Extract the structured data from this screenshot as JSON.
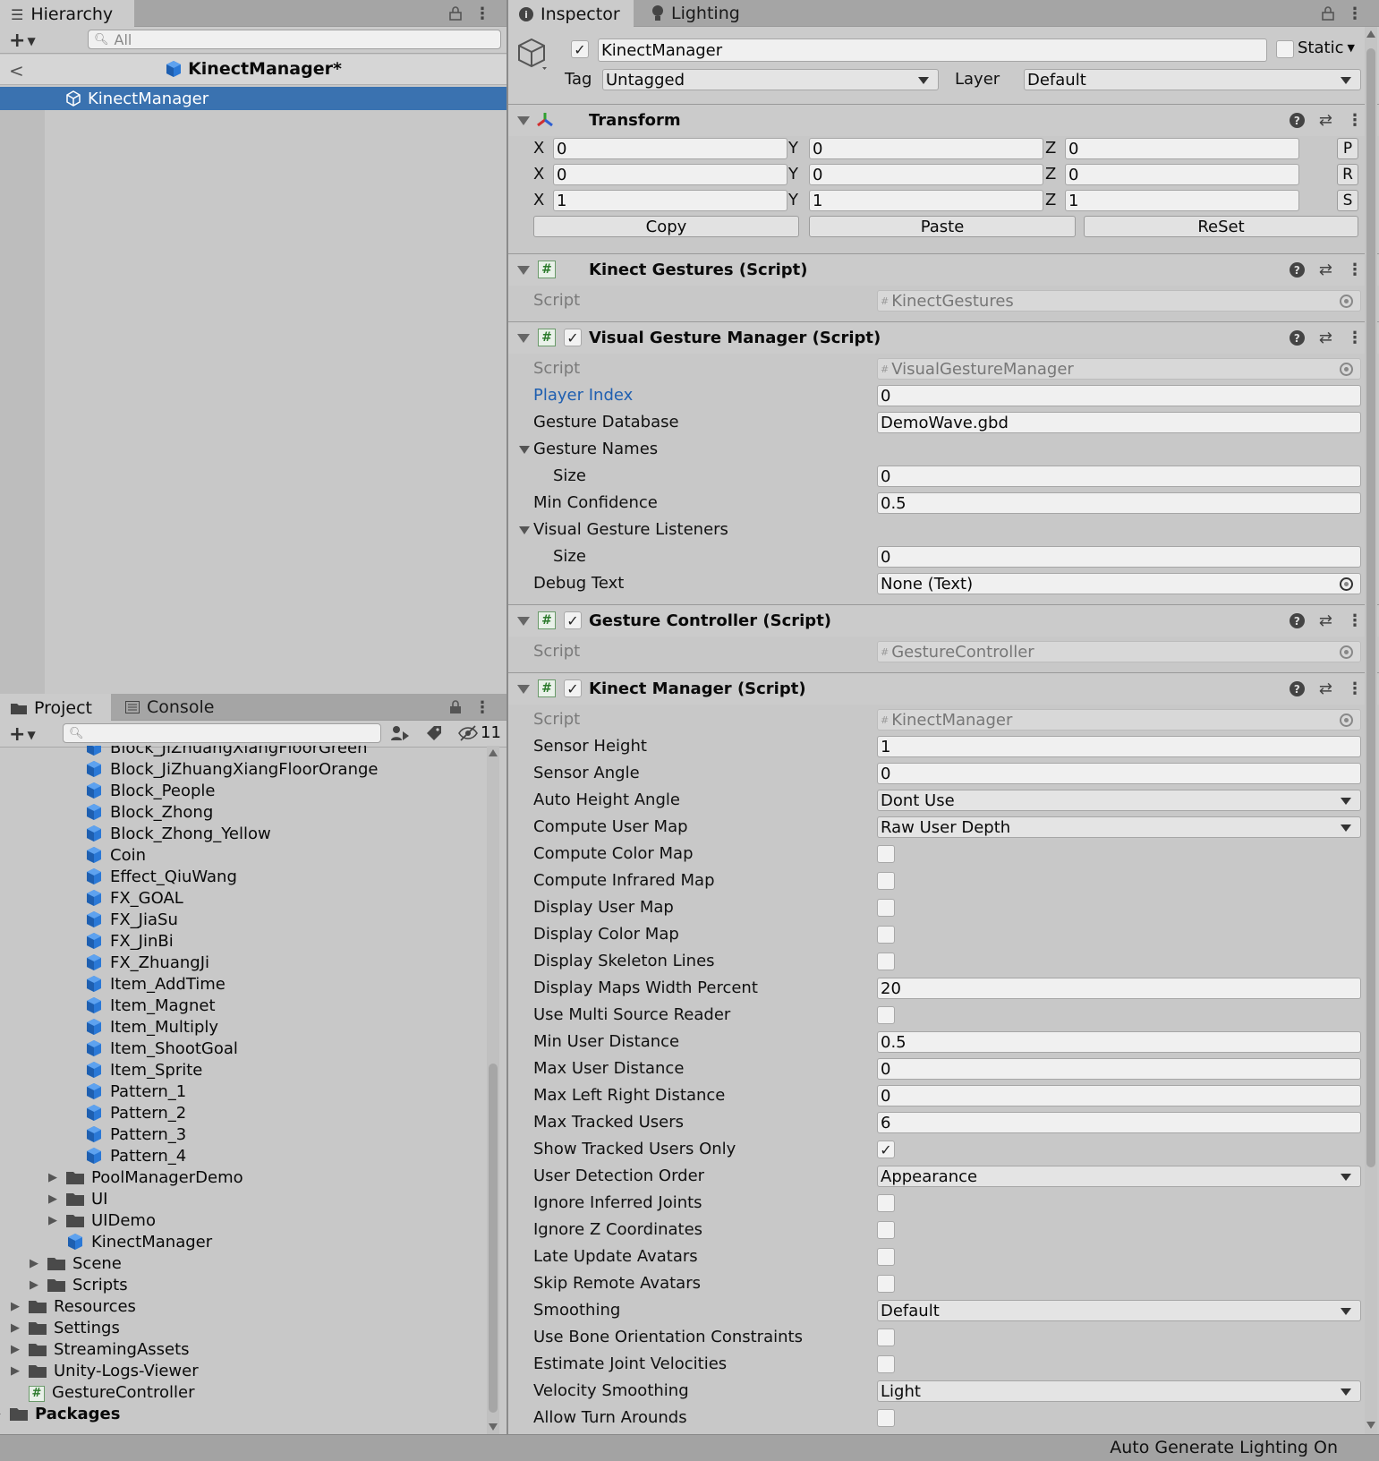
{
  "hierarchy": {
    "tab_label": "Hierarchy",
    "search_placeholder": "All",
    "scene_title": "KinectManager*",
    "selected_object": "KinectManager"
  },
  "project": {
    "tab_project": "Project",
    "tab_console": "Console",
    "hidden_count": "11",
    "items": [
      {
        "label": "Block_JiZhuangXiangFloorGreen",
        "kind": "prefab",
        "depth": 3,
        "expander": "none"
      },
      {
        "label": "Block_JiZhuangXiangFloorOrange",
        "kind": "prefab",
        "depth": 3,
        "expander": "none"
      },
      {
        "label": "Block_People",
        "kind": "prefab",
        "depth": 3,
        "expander": "none"
      },
      {
        "label": "Block_Zhong",
        "kind": "prefab",
        "depth": 3,
        "expander": "none"
      },
      {
        "label": "Block_Zhong_Yellow",
        "kind": "prefab",
        "depth": 3,
        "expander": "none"
      },
      {
        "label": "Coin",
        "kind": "prefab",
        "depth": 3,
        "expander": "none"
      },
      {
        "label": "Effect_QiuWang",
        "kind": "prefab",
        "depth": 3,
        "expander": "none"
      },
      {
        "label": "FX_GOAL",
        "kind": "prefab",
        "depth": 3,
        "expander": "none"
      },
      {
        "label": "FX_JiaSu",
        "kind": "prefab",
        "depth": 3,
        "expander": "none"
      },
      {
        "label": "FX_JinBi",
        "kind": "prefab",
        "depth": 3,
        "expander": "none"
      },
      {
        "label": "FX_ZhuangJi",
        "kind": "prefab",
        "depth": 3,
        "expander": "none"
      },
      {
        "label": "Item_AddTime",
        "kind": "prefab",
        "depth": 3,
        "expander": "none"
      },
      {
        "label": "Item_Magnet",
        "kind": "prefab",
        "depth": 3,
        "expander": "none"
      },
      {
        "label": "Item_Multiply",
        "kind": "prefab",
        "depth": 3,
        "expander": "none"
      },
      {
        "label": "Item_ShootGoal",
        "kind": "prefab",
        "depth": 3,
        "expander": "none"
      },
      {
        "label": "Item_Sprite",
        "kind": "prefab",
        "depth": 3,
        "expander": "none"
      },
      {
        "label": "Pattern_1",
        "kind": "prefab",
        "depth": 3,
        "expander": "none"
      },
      {
        "label": "Pattern_2",
        "kind": "prefab",
        "depth": 3,
        "expander": "none"
      },
      {
        "label": "Pattern_3",
        "kind": "prefab",
        "depth": 3,
        "expander": "none"
      },
      {
        "label": "Pattern_4",
        "kind": "prefab",
        "depth": 3,
        "expander": "none"
      },
      {
        "label": "PoolManagerDemo",
        "kind": "folder",
        "depth": 2,
        "expander": "closed"
      },
      {
        "label": "UI",
        "kind": "folder",
        "depth": 2,
        "expander": "closed"
      },
      {
        "label": "UIDemo",
        "kind": "folder",
        "depth": 2,
        "expander": "closed"
      },
      {
        "label": "KinectManager",
        "kind": "prefab",
        "depth": 2,
        "expander": "none"
      },
      {
        "label": "Scene",
        "kind": "folder",
        "depth": 1,
        "expander": "closed"
      },
      {
        "label": "Scripts",
        "kind": "folder",
        "depth": 1,
        "expander": "closed"
      },
      {
        "label": "Resources",
        "kind": "folder",
        "depth": 0,
        "expander": "closed"
      },
      {
        "label": "Settings",
        "kind": "folder",
        "depth": 0,
        "expander": "closed"
      },
      {
        "label": "StreamingAssets",
        "kind": "folder",
        "depth": 0,
        "expander": "closed"
      },
      {
        "label": "Unity-Logs-Viewer",
        "kind": "folder",
        "depth": 0,
        "expander": "closed"
      },
      {
        "label": "GestureController",
        "kind": "script",
        "depth": 0,
        "expander": "none"
      },
      {
        "label": "Packages",
        "kind": "folder",
        "depth": -1,
        "expander": "closed",
        "bold": true
      }
    ]
  },
  "inspector": {
    "tab_inspector": "Inspector",
    "tab_lighting": "Lighting",
    "object_name": "KinectManager",
    "object_active": true,
    "static_label": "Static",
    "tag_label": "Tag",
    "tag_value": "Untagged",
    "layer_label": "Layer",
    "layer_value": "Default",
    "transform": {
      "title": "Transform",
      "position": {
        "x": "0",
        "y": "0",
        "z": "0",
        "btn": "P"
      },
      "rotation": {
        "x": "0",
        "y": "0",
        "z": "0",
        "btn": "R"
      },
      "scale": {
        "x": "1",
        "y": "1",
        "z": "1",
        "btn": "S"
      },
      "axis_x": "X",
      "axis_y": "Y",
      "axis_z": "Z",
      "copy": "Copy",
      "paste": "Paste",
      "reset": "ReSet"
    },
    "kinect_gestures": {
      "title": "Kinect Gestures (Script)",
      "script_label": "Script",
      "script_value": "KinectGestures"
    },
    "visual_gesture_manager": {
      "title": "Visual Gesture Manager (Script)",
      "script_label": "Script",
      "script_value": "VisualGestureManager",
      "player_index_label": "Player Index",
      "player_index": "0",
      "gesture_database_label": "Gesture Database",
      "gesture_database": "DemoWave.gbd",
      "gesture_names_label": "Gesture Names",
      "size_label": "Size",
      "gesture_names_size": "0",
      "min_confidence_label": "Min Confidence",
      "min_confidence": "0.5",
      "listeners_label": "Visual Gesture Listeners",
      "listeners_size": "0",
      "debug_text_label": "Debug Text",
      "debug_text": "None (Text)"
    },
    "gesture_controller": {
      "title": "Gesture Controller (Script)",
      "script_label": "Script",
      "script_value": "GestureController"
    },
    "kinect_manager": {
      "title": "Kinect Manager (Script)",
      "script_label": "Script",
      "script_value": "KinectManager",
      "props": [
        {
          "label": "Sensor Height",
          "type": "text",
          "value": "1"
        },
        {
          "label": "Sensor Angle",
          "type": "text",
          "value": "0"
        },
        {
          "label": "Auto Height Angle",
          "type": "dropdown",
          "value": "Dont Use"
        },
        {
          "label": "Compute User Map",
          "type": "dropdown",
          "value": "Raw User Depth"
        },
        {
          "label": "Compute Color Map",
          "type": "check",
          "value": false
        },
        {
          "label": "Compute Infrared Map",
          "type": "check",
          "value": false
        },
        {
          "label": "Display User Map",
          "type": "check",
          "value": false
        },
        {
          "label": "Display Color Map",
          "type": "check",
          "value": false
        },
        {
          "label": "Display Skeleton Lines",
          "type": "check",
          "value": false
        },
        {
          "label": "Display Maps Width Percent",
          "type": "text",
          "value": "20"
        },
        {
          "label": "Use Multi Source Reader",
          "type": "check",
          "value": false
        },
        {
          "label": "Min User Distance",
          "type": "text",
          "value": "0.5"
        },
        {
          "label": "Max User Distance",
          "type": "text",
          "value": "0"
        },
        {
          "label": "Max Left Right Distance",
          "type": "text",
          "value": "0"
        },
        {
          "label": "Max Tracked Users",
          "type": "text",
          "value": "6"
        },
        {
          "label": "Show Tracked Users Only",
          "type": "check",
          "value": true
        },
        {
          "label": "User Detection Order",
          "type": "dropdown",
          "value": "Appearance"
        },
        {
          "label": "Ignore Inferred Joints",
          "type": "check",
          "value": false
        },
        {
          "label": "Ignore Z Coordinates",
          "type": "check",
          "value": false
        },
        {
          "label": "Late Update Avatars",
          "type": "check",
          "value": false
        },
        {
          "label": "Skip Remote Avatars",
          "type": "check",
          "value": false
        },
        {
          "label": "Smoothing",
          "type": "dropdown",
          "value": "Default"
        },
        {
          "label": "Use Bone Orientation Constraints",
          "type": "check",
          "value": false
        },
        {
          "label": "Estimate Joint Velocities",
          "type": "check",
          "value": false
        },
        {
          "label": "Velocity Smoothing",
          "type": "dropdown",
          "value": "Light"
        },
        {
          "label": "Allow Turn Arounds",
          "type": "check",
          "value": false
        }
      ]
    }
  },
  "status_bar": {
    "text": "Auto Generate Lighting On"
  },
  "colors": {
    "selection": "#3a72b0",
    "prefab_blue": "#2a78d6",
    "folder": "#4a4a4a"
  }
}
